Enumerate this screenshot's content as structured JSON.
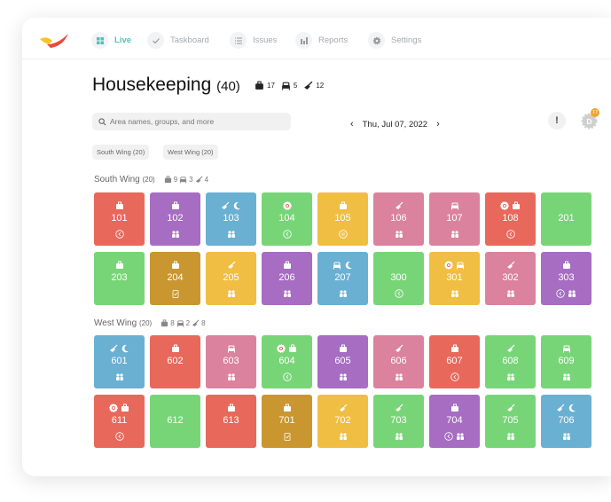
{
  "nav": {
    "items": [
      {
        "label": "Live",
        "icon": "grid-icon",
        "active": true
      },
      {
        "label": "Taskboard",
        "icon": "check-icon"
      },
      {
        "label": "Issues",
        "icon": "list-icon"
      },
      {
        "label": "Reports",
        "icon": "bar-chart-icon"
      },
      {
        "label": "Settings",
        "icon": "gear-icon"
      }
    ]
  },
  "header": {
    "title": "Housekeeping",
    "count": "(40)",
    "stats": {
      "checkout": "17",
      "bed": "5",
      "clean": "12"
    }
  },
  "search": {
    "placeholder": "Area names, groups, and more"
  },
  "date": {
    "label": "Thu, Jul 07, 2022"
  },
  "alert": {
    "label": "!"
  },
  "avatar": {
    "initial": "D",
    "badge": "17"
  },
  "chips": [
    "South Wing (20)",
    "West Wing (20)"
  ],
  "colors": {
    "red": "#e8685c",
    "purple": "#a66dc2",
    "blue": "#6ab0d2",
    "green": "#78d577",
    "yellow": "#f0be42",
    "pink": "#db829f",
    "gold": "#c9962f",
    "accent": "#4cc3b7"
  },
  "groups": [
    {
      "name": "South Wing",
      "count": "(20)",
      "stats": {
        "checkout": "9",
        "bed": "3",
        "clean": "4"
      },
      "rows": [
        [
          {
            "n": "101",
            "c": "red",
            "t": [
              "suitcase"
            ],
            "b": [
              "arrow"
            ]
          },
          {
            "n": "102",
            "c": "purple",
            "t": [
              "suitcase"
            ],
            "b": [
              "people"
            ]
          },
          {
            "n": "103",
            "c": "blue",
            "t": [
              "broom",
              "moon"
            ],
            "b": [
              "people"
            ]
          },
          {
            "n": "104",
            "c": "green",
            "t": [
              "dnd"
            ],
            "b": [
              "arrow"
            ]
          },
          {
            "n": "105",
            "c": "yellow",
            "t": [
              "suitcase"
            ],
            "b": [
              "pause"
            ]
          },
          {
            "n": "106",
            "c": "pink",
            "t": [
              "broom"
            ],
            "b": [
              "people"
            ]
          },
          {
            "n": "107",
            "c": "pink",
            "t": [
              "bed"
            ],
            "b": [
              "people"
            ]
          },
          {
            "n": "108",
            "c": "red",
            "t": [
              "dnd",
              "suitcase"
            ],
            "b": [
              "arrow"
            ]
          },
          {
            "n": "201",
            "c": "green",
            "t": [],
            "b": []
          }
        ],
        [
          {
            "n": "203",
            "c": "green",
            "t": [
              "suitcase"
            ],
            "b": []
          },
          {
            "n": "204",
            "c": "gold",
            "t": [
              "suitcase"
            ],
            "b": [
              "clipboard"
            ]
          },
          {
            "n": "205",
            "c": "yellow",
            "t": [
              "broom"
            ],
            "b": [
              "people"
            ]
          },
          {
            "n": "206",
            "c": "purple",
            "t": [
              "suitcase"
            ],
            "b": [
              "people"
            ]
          },
          {
            "n": "207",
            "c": "blue",
            "t": [
              "bed",
              "moon"
            ],
            "b": [
              "people"
            ]
          },
          {
            "n": "300",
            "c": "green",
            "t": [],
            "b": [
              "arrow"
            ]
          },
          {
            "n": "301",
            "c": "yellow",
            "t": [
              "dnd",
              "bed"
            ],
            "b": [
              "people"
            ]
          },
          {
            "n": "302",
            "c": "pink",
            "t": [
              "broom"
            ],
            "b": [
              "people"
            ]
          },
          {
            "n": "303",
            "c": "purple",
            "t": [
              "suitcase"
            ],
            "b": [
              "arrow",
              "people"
            ]
          }
        ]
      ]
    },
    {
      "name": "West Wing",
      "count": "(20)",
      "stats": {
        "checkout": "8",
        "bed": "2",
        "clean": "8"
      },
      "rows": [
        [
          {
            "n": "601",
            "c": "blue",
            "t": [
              "broom",
              "moon"
            ],
            "b": [
              "people"
            ]
          },
          {
            "n": "602",
            "c": "red",
            "t": [
              "suitcase"
            ],
            "b": []
          },
          {
            "n": "603",
            "c": "pink",
            "t": [
              "bed"
            ],
            "b": [
              "people"
            ]
          },
          {
            "n": "604",
            "c": "green",
            "t": [
              "dnd",
              "suitcase"
            ],
            "b": [
              "arrow"
            ]
          },
          {
            "n": "605",
            "c": "purple",
            "t": [
              "suitcase"
            ],
            "b": [
              "people"
            ]
          },
          {
            "n": "606",
            "c": "pink",
            "t": [
              "broom"
            ],
            "b": [
              "people"
            ]
          },
          {
            "n": "607",
            "c": "red",
            "t": [
              "suitcase"
            ],
            "b": [
              "arrow"
            ]
          },
          {
            "n": "608",
            "c": "green",
            "t": [
              "broom"
            ],
            "b": [
              "people"
            ]
          },
          {
            "n": "609",
            "c": "green",
            "t": [
              "bed"
            ],
            "b": [
              "people"
            ]
          }
        ],
        [
          {
            "n": "611",
            "c": "red",
            "t": [
              "dnd",
              "suitcase"
            ],
            "b": [
              "arrow"
            ]
          },
          {
            "n": "612",
            "c": "green",
            "t": [],
            "b": []
          },
          {
            "n": "613",
            "c": "red",
            "t": [
              "suitcase"
            ],
            "b": []
          },
          {
            "n": "701",
            "c": "gold",
            "t": [
              "suitcase"
            ],
            "b": [
              "clipboard"
            ]
          },
          {
            "n": "702",
            "c": "yellow",
            "t": [
              "broom"
            ],
            "b": [
              "people"
            ]
          },
          {
            "n": "703",
            "c": "green",
            "t": [
              "broom"
            ],
            "b": [
              "people"
            ]
          },
          {
            "n": "704",
            "c": "purple",
            "t": [
              "suitcase"
            ],
            "b": [
              "arrow",
              "people"
            ]
          },
          {
            "n": "705",
            "c": "green",
            "t": [
              "broom"
            ],
            "b": [
              "people"
            ]
          },
          {
            "n": "706",
            "c": "blue",
            "t": [
              "broom",
              "moon"
            ],
            "b": [
              "people"
            ]
          }
        ]
      ]
    }
  ]
}
